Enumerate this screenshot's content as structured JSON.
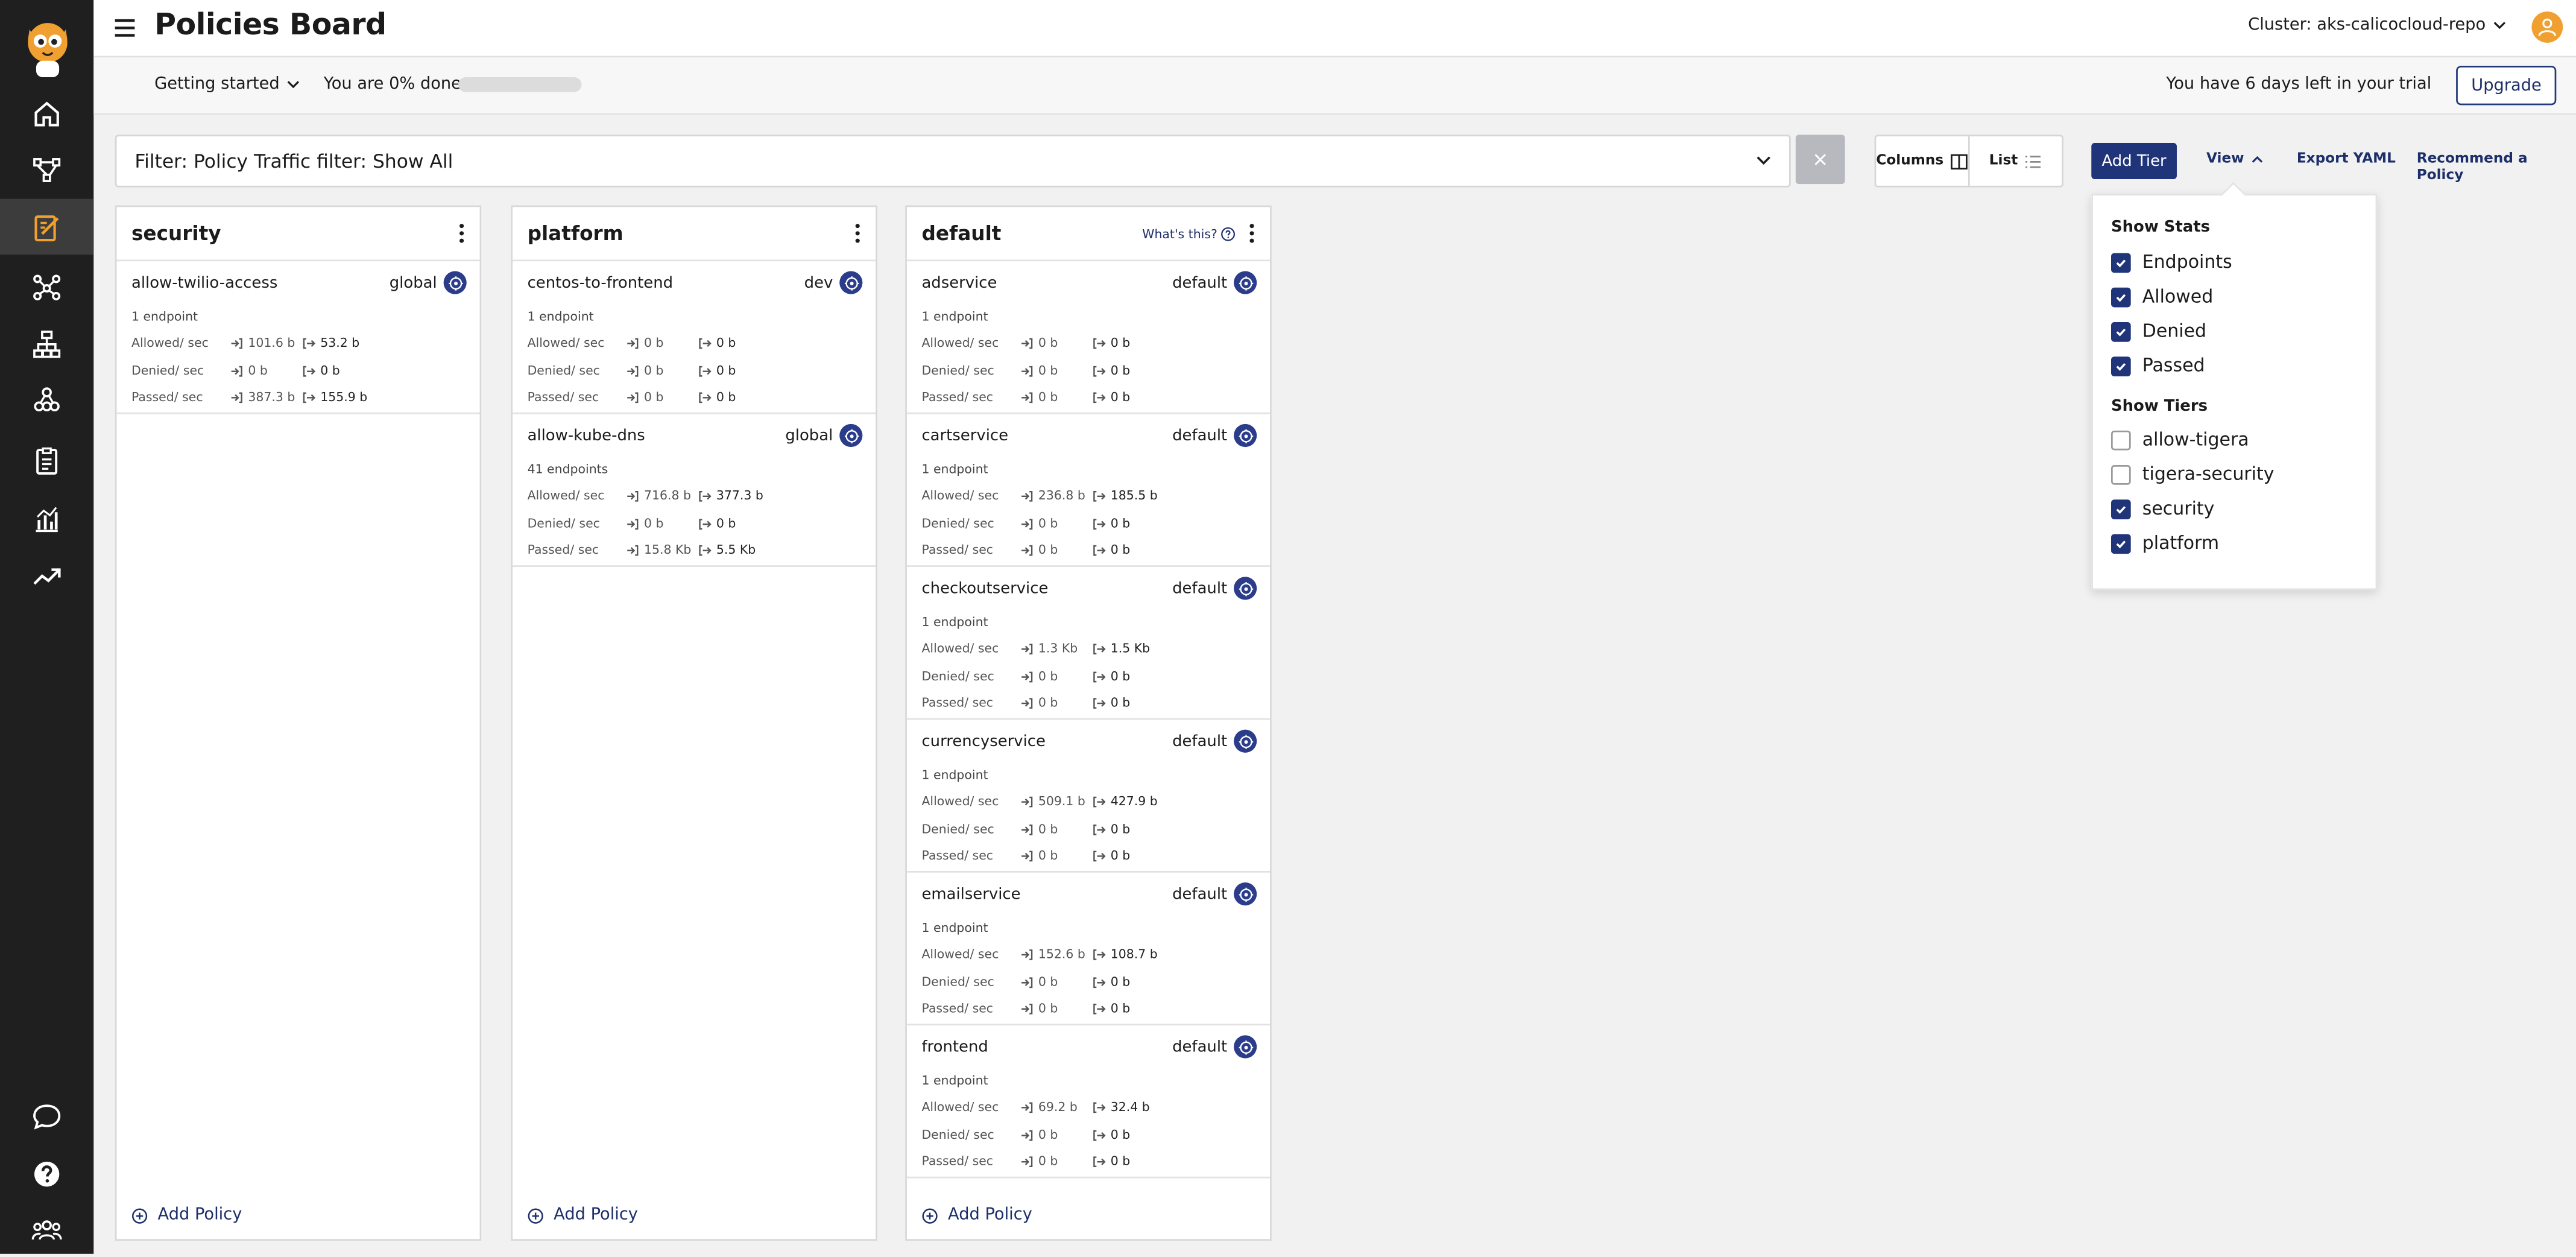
{
  "header": {
    "title": "Policies Board",
    "cluster": "Cluster: aks-calicocloud-repo"
  },
  "onboarding": {
    "getting_started": "Getting started",
    "progress_text": "You are 0% done",
    "progress_fraction": 0,
    "trial_text": "You have 6 days left in your trial",
    "upgrade_label": "Upgrade"
  },
  "toolbar": {
    "filter_text": "Filter: Policy Traffic filter: Show All",
    "clear_label": "×",
    "columns_label": "Columns",
    "list_label": "List",
    "add_tier_label": "Add Tier",
    "view_label": "View",
    "export_yaml_label": "Export YAML",
    "recommend_label": "Recommend a Policy"
  },
  "view_popover": {
    "stats_heading": "Show Stats",
    "stats": [
      {
        "label": "Endpoints",
        "checked": true
      },
      {
        "label": "Allowed",
        "checked": true
      },
      {
        "label": "Denied",
        "checked": true
      },
      {
        "label": "Passed",
        "checked": true
      }
    ],
    "tiers_heading": "Show Tiers",
    "tiers": [
      {
        "label": "allow-tigera",
        "checked": false
      },
      {
        "label": "tigera-security",
        "checked": false
      },
      {
        "label": "security",
        "checked": true
      },
      {
        "label": "platform",
        "checked": true
      }
    ]
  },
  "board": {
    "stat_labels": {
      "allowed": "Allowed/ sec",
      "denied": "Denied/ sec",
      "passed": "Passed/ sec"
    },
    "add_policy_label": "Add Policy",
    "whats_this": "What's this?",
    "tiers": [
      {
        "name": "security",
        "policies": [
          {
            "name": "allow-twilio-access",
            "scope": "global",
            "endpoints": "1 endpoint",
            "allowed": [
              "101.6 b",
              "53.2 b"
            ],
            "denied": [
              "0 b",
              "0 b"
            ],
            "passed": [
              "387.3 b",
              "155.9 b"
            ]
          }
        ]
      },
      {
        "name": "platform",
        "policies": [
          {
            "name": "centos-to-frontend",
            "scope": "dev",
            "endpoints": "1 endpoint",
            "allowed": [
              "0 b",
              "0 b"
            ],
            "denied": [
              "0 b",
              "0 b"
            ],
            "passed": [
              "0 b",
              "0 b"
            ]
          },
          {
            "name": "allow-kube-dns",
            "scope": "global",
            "endpoints": "41 endpoints",
            "allowed": [
              "716.8 b",
              "377.3 b"
            ],
            "denied": [
              "0 b",
              "0 b"
            ],
            "passed": [
              "15.8 Kb",
              "5.5 Kb"
            ]
          }
        ]
      },
      {
        "name": "default",
        "policies": [
          {
            "name": "adservice",
            "scope": "default",
            "endpoints": "1 endpoint",
            "allowed": [
              "0 b",
              "0 b"
            ],
            "denied": [
              "0 b",
              "0 b"
            ],
            "passed": [
              "0 b",
              "0 b"
            ]
          },
          {
            "name": "cartservice",
            "scope": "default",
            "endpoints": "1 endpoint",
            "allowed": [
              "236.8 b",
              "185.5 b"
            ],
            "denied": [
              "0 b",
              "0 b"
            ],
            "passed": [
              "0 b",
              "0 b"
            ]
          },
          {
            "name": "checkoutservice",
            "scope": "default",
            "endpoints": "1 endpoint",
            "allowed": [
              "1.3 Kb",
              "1.5 Kb"
            ],
            "denied": [
              "0 b",
              "0 b"
            ],
            "passed": [
              "0 b",
              "0 b"
            ]
          },
          {
            "name": "currencyservice",
            "scope": "default",
            "endpoints": "1 endpoint",
            "allowed": [
              "509.1 b",
              "427.9 b"
            ],
            "denied": [
              "0 b",
              "0 b"
            ],
            "passed": [
              "0 b",
              "0 b"
            ]
          },
          {
            "name": "emailservice",
            "scope": "default",
            "endpoints": "1 endpoint",
            "allowed": [
              "152.6 b",
              "108.7 b"
            ],
            "denied": [
              "0 b",
              "0 b"
            ],
            "passed": [
              "0 b",
              "0 b"
            ]
          },
          {
            "name": "frontend",
            "scope": "default",
            "endpoints": "1 endpoint",
            "allowed": [
              "69.2 b",
              "32.4 b"
            ],
            "denied": [
              "0 b",
              "0 b"
            ],
            "passed": [
              "0 b",
              "0 b"
            ]
          }
        ]
      }
    ]
  },
  "colors": {
    "sidebar": "#1f1f1f",
    "primary": "#1f3479",
    "accent": "#f0a030",
    "active_nav": "#3c3c3c"
  },
  "icons": [
    "home-icon",
    "graph-icon",
    "policies-icon",
    "endpoints-icon",
    "hierarchy-icon",
    "cluster-icon",
    "compliance-icon",
    "analytics-icon",
    "trend-icon",
    "chat-icon",
    "help-icon",
    "team-icon"
  ]
}
